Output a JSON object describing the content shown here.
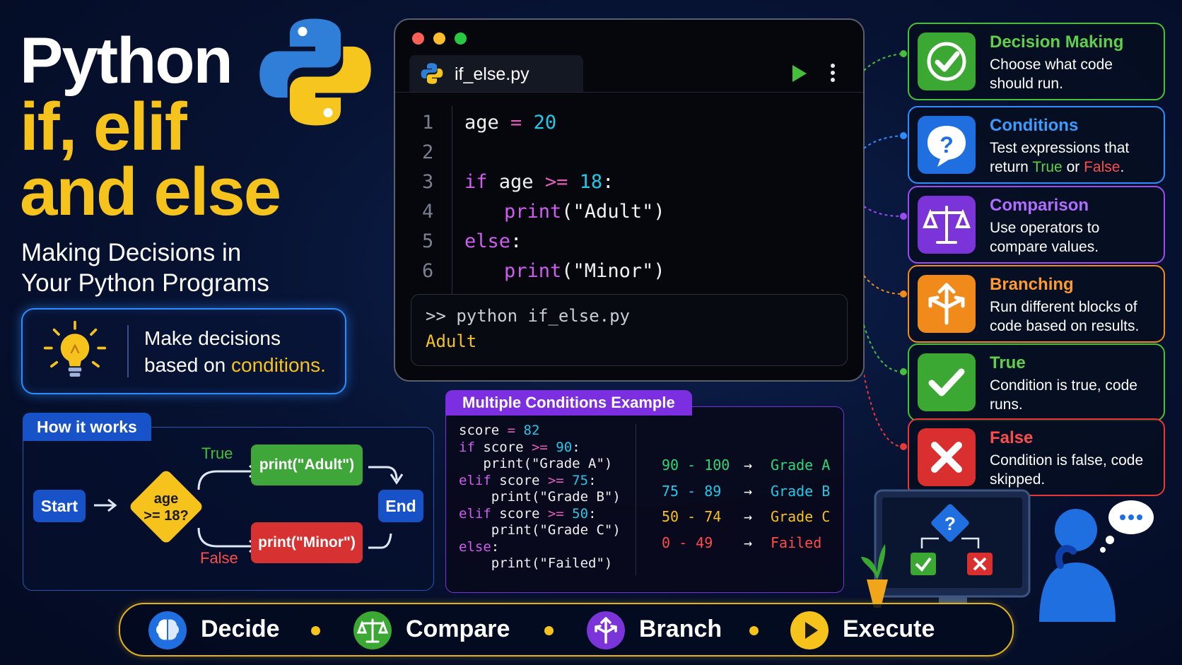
{
  "title": {
    "line1": "Python",
    "line2": "if, elif",
    "line3": "and else"
  },
  "subtitle": {
    "line1": "Making Decisions in",
    "line2": "Your Python Programs"
  },
  "tip": {
    "part1": "Make decisions",
    "part2": "based on ",
    "highlight": "conditions."
  },
  "how": {
    "header": "How it works",
    "start": "Start",
    "decision_line1": "age",
    "decision_line2": ">= 18?",
    "true_label": "True",
    "false_label": "False",
    "true_action": "print(\"Adult\")",
    "false_action": "print(\"Minor\")",
    "end": "End"
  },
  "editor": {
    "tab_filename": "if_else.py",
    "line_numbers": [
      "1",
      "2",
      "3",
      "4",
      "5",
      "6"
    ],
    "code": {
      "l1_var": "age",
      "l1_op": "=",
      "l1_num": "20",
      "l3_kw": "if",
      "l3_var": "age",
      "l3_op": ">=",
      "l3_num": "18",
      "l3_colon": ":",
      "l4_fn": "print",
      "l4_open": "(",
      "l4_str": "\"Adult\"",
      "l4_close": ")",
      "l5_kw": "else",
      "l5_colon": ":",
      "l6_fn": "print",
      "l6_open": "(",
      "l6_str": "\"Minor\"",
      "l6_close": ")"
    },
    "terminal_command": ">> python if_else.py",
    "terminal_output": "Adult"
  },
  "multi": {
    "header": "Multiple Conditions Example",
    "code_lines": [
      {
        "kw": "",
        "rest": "score ",
        "op": "=",
        "num": " 82",
        "tail": ""
      },
      {
        "kw": "if",
        "rest": " score ",
        "op": ">=",
        "num": " 90",
        "tail": ":"
      },
      {
        "kw": "",
        "rest": "   print(\"Grade A\")",
        "op": "",
        "num": "",
        "tail": ""
      },
      {
        "kw": "elif",
        "rest": " score ",
        "op": ">=",
        "num": " 75",
        "tail": ":"
      },
      {
        "kw": "",
        "rest": "    print(\"Grade B\")",
        "op": "",
        "num": "",
        "tail": ""
      },
      {
        "kw": "elif",
        "rest": " score ",
        "op": ">=",
        "num": " 50",
        "tail": ":"
      },
      {
        "kw": "",
        "rest": "    print(\"Grade C\")",
        "op": "",
        "num": "",
        "tail": ""
      },
      {
        "kw": "else",
        "rest": ":",
        "op": "",
        "num": "",
        "tail": ""
      },
      {
        "kw": "",
        "rest": "    print(\"Failed\")",
        "op": "",
        "num": "",
        "tail": ""
      }
    ],
    "grades": [
      {
        "range": "90 - 100",
        "arrow": "→",
        "grade": "Grade A",
        "color": "#2fd67a",
        "gcolor": "#2fd67a"
      },
      {
        "range": "75 - 89",
        "arrow": "→",
        "grade": "Grade B",
        "color": "#23c8e8",
        "gcolor": "#23c8e8"
      },
      {
        "range": "50 - 74",
        "arrow": "→",
        "grade": "Grade C",
        "color": "#f6c21c",
        "gcolor": "#f6c21c"
      },
      {
        "range": "0 - 49",
        "arrow": "→",
        "grade": "Failed",
        "color": "#ff4b4b",
        "gcolor": "#ff4b4b"
      }
    ]
  },
  "cards": [
    {
      "title": "Decision Making",
      "desc": "Choose what code should run.",
      "color": "#46c03a",
      "icon": "check-badge-icon"
    },
    {
      "title": "Conditions",
      "desc_pre": "Test expressions that return ",
      "true_word": "True",
      "or_word": " or ",
      "false_word": "False",
      "period": ".",
      "color": "#2e8cff",
      "icon": "question-bubble-icon"
    },
    {
      "title": "Comparison",
      "desc": "Use operators to compare values.",
      "color": "#9b4cf0",
      "icon": "scales-icon"
    },
    {
      "title": "Branching",
      "desc": "Run different blocks of code based on results.",
      "color": "#f08a1a",
      "icon": "branch-arrows-icon"
    },
    {
      "title": "True",
      "desc": "Condition is true, code runs.",
      "color": "#46c03a",
      "icon": "check-icon"
    },
    {
      "title": "False",
      "desc": "Condition is false, code skipped.",
      "color": "#e83838",
      "icon": "x-icon"
    }
  ],
  "bottom": {
    "decide": "Decide",
    "compare": "Compare",
    "branch": "Branch",
    "execute": "Execute"
  },
  "colors": {
    "yellow": "#f6c21c",
    "blue": "#2e8cff",
    "purple": "#7b2fe0",
    "green": "#46c03a",
    "red": "#e83838",
    "orange": "#f08a1a"
  }
}
